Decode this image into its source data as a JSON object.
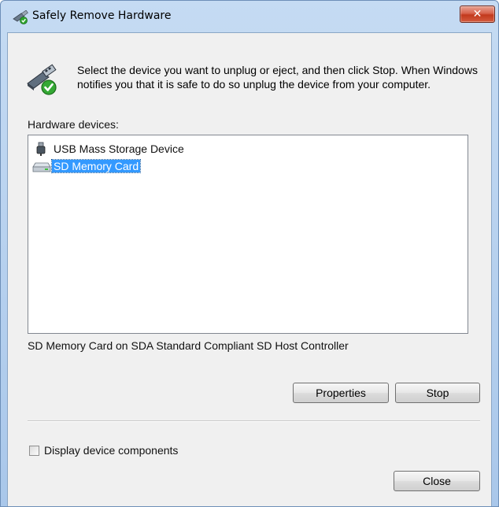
{
  "window": {
    "title": "Safely Remove Hardware",
    "close_glyph": "✕"
  },
  "instructions": "Select the device you want to unplug or eject, and then click Stop. When Windows notifies you that it is safe to do so unplug the device from your computer.",
  "hardware_label": "Hardware devices:",
  "devices": [
    {
      "label": "USB Mass Storage Device",
      "icon": "usb-plug-icon",
      "selected": false
    },
    {
      "label": "SD Memory Card",
      "icon": "drive-icon",
      "selected": true
    }
  ],
  "status_text": "SD Memory Card on SDA Standard Compliant SD Host Controller",
  "buttons": {
    "properties": "Properties",
    "stop": "Stop",
    "close": "Close"
  },
  "display_components": {
    "label": "Display device components",
    "checked": false
  },
  "colors": {
    "selection": "#3399ff",
    "frame": "#a9c7ea",
    "close_button": "#c2391d"
  }
}
